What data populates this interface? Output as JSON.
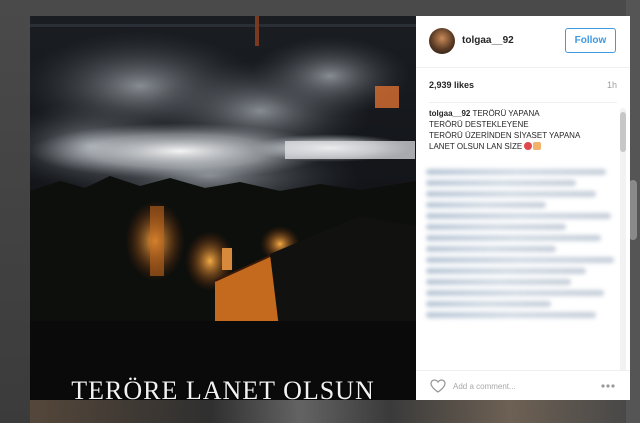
{
  "post": {
    "username": "tolgaa__92",
    "follow_label": "Follow",
    "likes": "2,939 likes",
    "timestamp": "1h",
    "caption_user": "tolgaa__92",
    "caption_lines": [
      "TERÖRÜ YAPANA",
      "TERÖRÜ DESTEKLEYENE",
      "TERÖRÜ ÜZERİNDEN SİYASET YAPANA",
      "LANET OLSUN LAN SİZE"
    ],
    "image_caption": "TERÖRE LANET OLSUN",
    "comment_placeholder": "Add a comment..."
  },
  "icons": {
    "like": "heart-icon",
    "more": "more-options-icon",
    "avatar": "avatar"
  },
  "colors": {
    "follow_accent": "#3f9ae0",
    "text": "#262626",
    "muted": "#a0a0a0"
  }
}
